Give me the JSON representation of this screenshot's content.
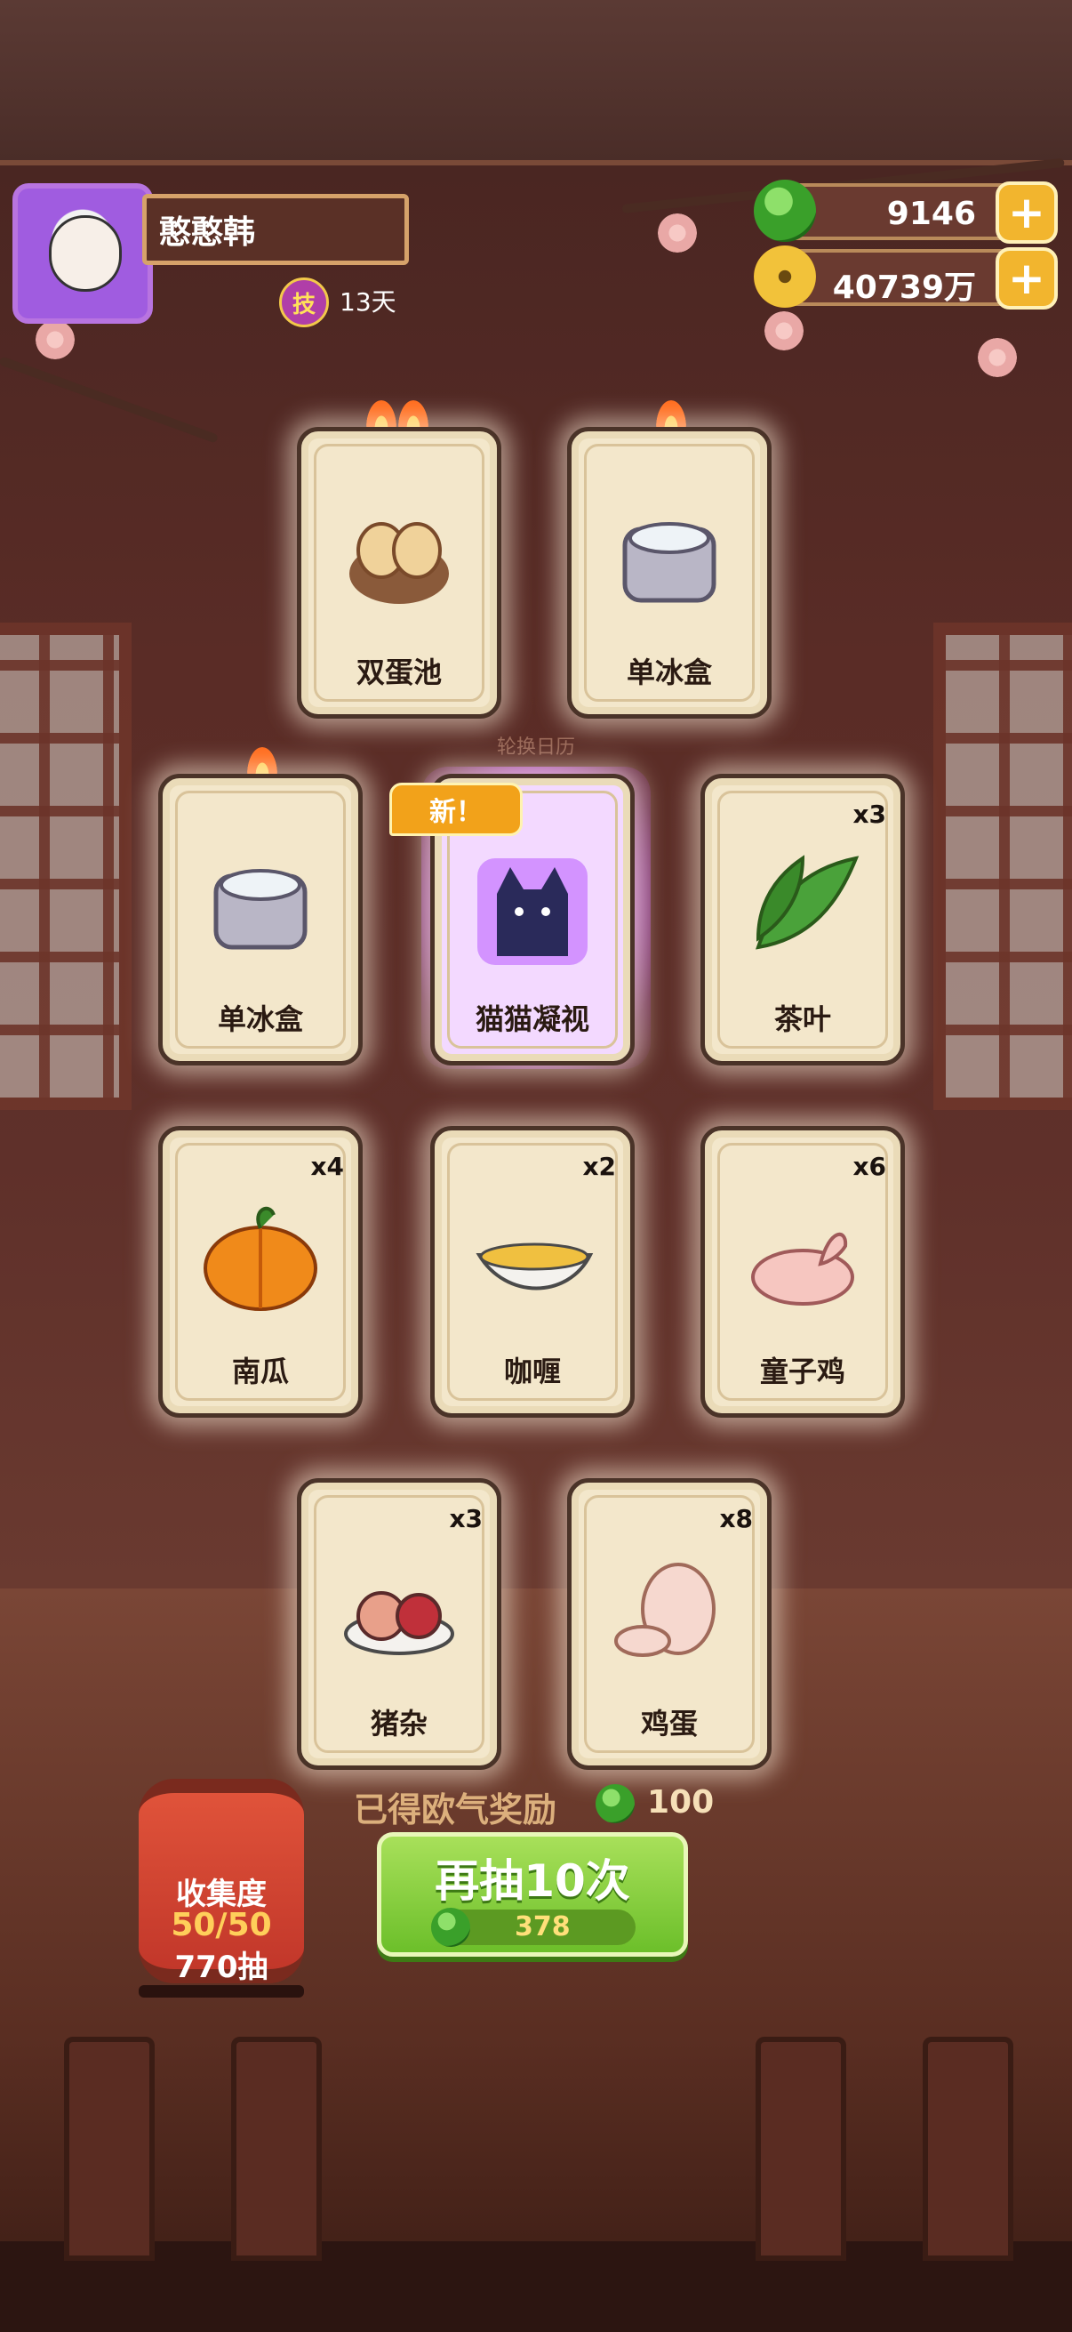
{
  "header": {
    "player_name": "憨憨韩",
    "skill_badge": "技",
    "skill_days": "13天"
  },
  "currency": {
    "jade_value": "9146",
    "coin_value": "40739万",
    "plus_symbol": "+"
  },
  "calendar_label": "轮换日历",
  "new_badge": "新！",
  "cards": [
    {
      "label": "双蛋池",
      "count": ""
    },
    {
      "label": "单冰盒",
      "count": ""
    },
    {
      "label": "单冰盒",
      "count": ""
    },
    {
      "label": "猫猫凝视",
      "count": ""
    },
    {
      "label": "茶叶",
      "count": "x3"
    },
    {
      "label": "南瓜",
      "count": "x4"
    },
    {
      "label": "咖喱",
      "count": "x2"
    },
    {
      "label": "童子鸡",
      "count": "x6"
    },
    {
      "label": "猪杂",
      "count": "x3"
    },
    {
      "label": "鸡蛋",
      "count": "x8"
    }
  ],
  "reward": {
    "label": "已得欧气奖励",
    "value": "100"
  },
  "draw_button": {
    "label": "再抽10次",
    "cost": "378"
  },
  "collection": {
    "title": "收集度",
    "progress": "50/50",
    "draws": "770抽"
  },
  "colors": {
    "accent_green": "#6cbf2a",
    "gold": "#f2b52e",
    "new_purple": "#d36bff"
  }
}
